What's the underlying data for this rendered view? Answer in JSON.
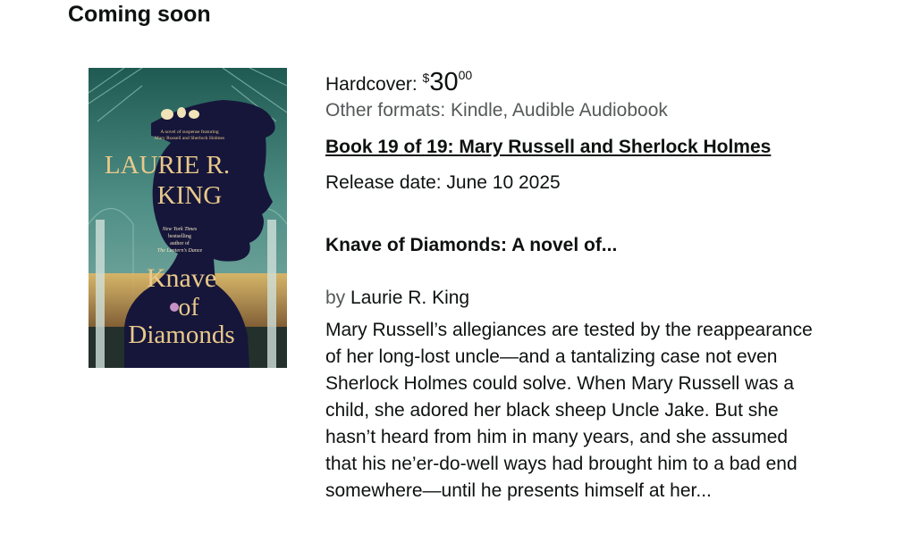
{
  "section": {
    "title": "Coming soon"
  },
  "product": {
    "cover": {
      "tagline_line1": "A novel of suspense featuring",
      "tagline_line2": "Mary Russell and Sherlock Holmes",
      "author_line1": "LAURIE R.",
      "author_line2": "KING",
      "blurb_line1": "New York Times",
      "blurb_line2": "bestselling",
      "blurb_line3": "author of",
      "blurb_line4": "The Lantern's Dance",
      "title_line1": "Knave",
      "title_line2": "of",
      "title_line3": "Diamonds",
      "colors": {
        "sky_top": "#2a6a60",
        "sky_mid": "#4f8f86",
        "silhouette": "#16163a",
        "gold_text": "#e9c98a",
        "lake": "#d7a64a"
      }
    },
    "format_label": "Hardcover:",
    "price": {
      "symbol": "$",
      "whole": "30",
      "fraction": "00"
    },
    "other_formats": "Other formats: Kindle, Audible Audiobook",
    "series": "Book 19 of 19: Mary Russell and Sherlock Holmes",
    "release_date": "Release date: June 10 2025",
    "title": "Knave of Diamonds: A novel of...",
    "by_label": "by",
    "author": "Laurie R. King",
    "description": "Mary Russell’s allegiances are tested by the reappearance of her long-lost uncle—and a tantalizing case not even Sherlock Holmes could solve. When Mary Russell was a child, she adored her black sheep Uncle Jake. But she hasn’t heard from him in many years, and she assumed that his ne’er-do-well ways had brought him to a bad end somewhere—until he presents himself at her..."
  }
}
